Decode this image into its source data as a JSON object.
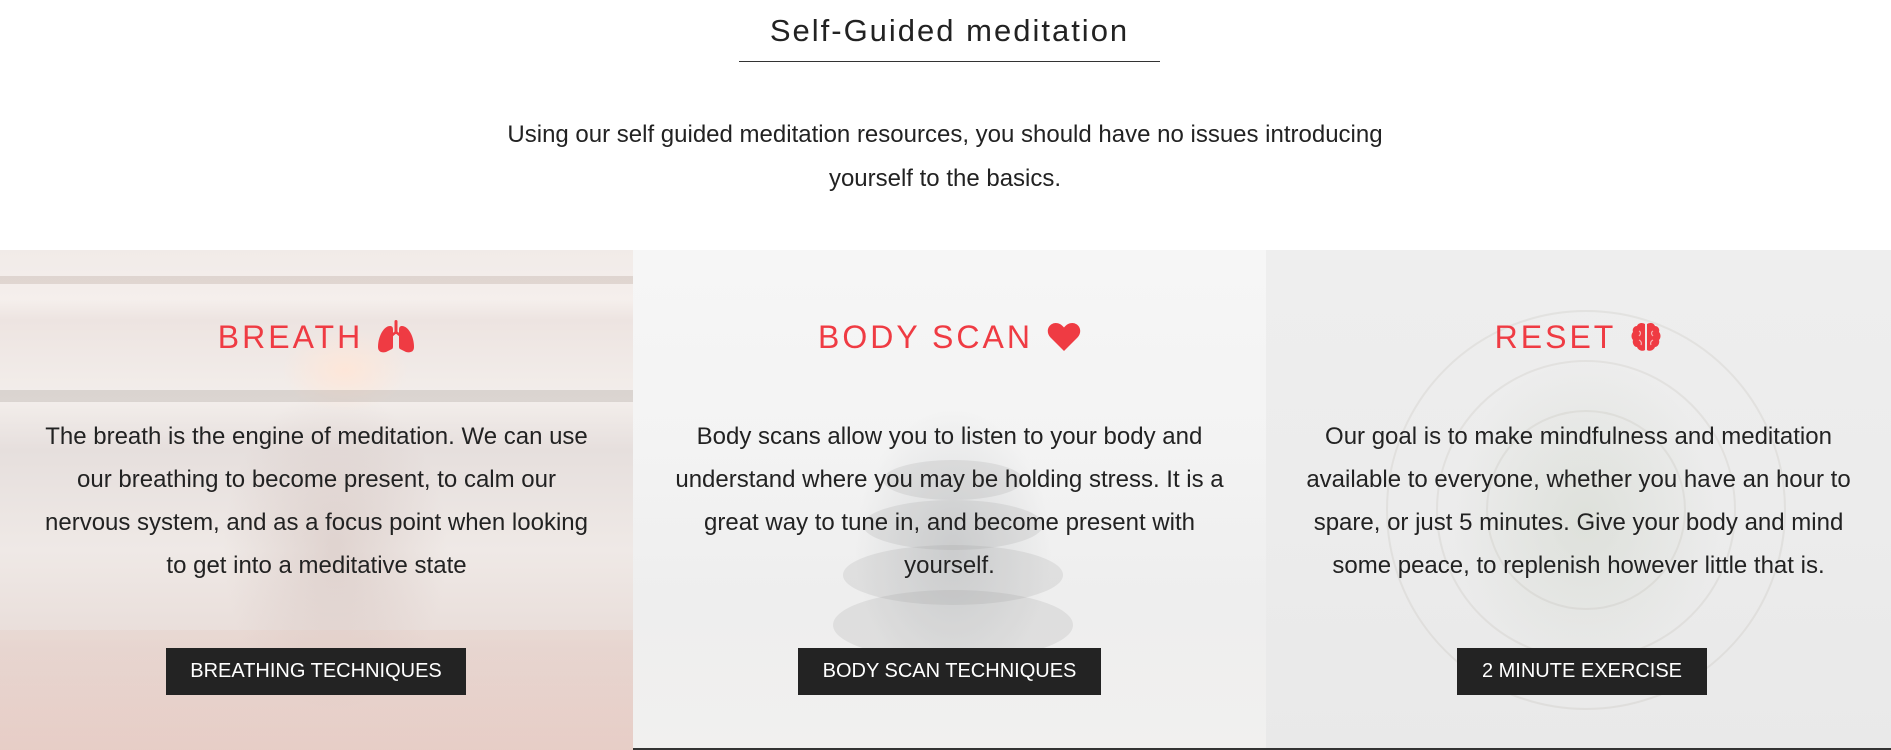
{
  "intro": {
    "title": "Self-Guided meditation",
    "subtitle": "Using our self guided meditation resources, you should have no issues introducing yourself to the basics."
  },
  "panels": [
    {
      "heading": "BREATH",
      "icon": "lungs-icon",
      "text": "The breath is the engine of meditation. We can use our breathing to become present, to calm our nervous system, and as a focus point when looking to get into a meditative state",
      "button_label": "BREATHING TECHNIQUES"
    },
    {
      "heading": "BODY SCAN",
      "icon": "heart-icon",
      "text": "Body scans allow you to listen to your body and understand where you may be holding stress. It is a great way to tune in, and become present with yourself.",
      "button_label": "BODY SCAN TECHNIQUES"
    },
    {
      "heading": "RESET",
      "icon": "brain-icon",
      "text": "Our goal is to make mindfulness and meditation available to everyone, whether you have an hour to spare, or just 5 minutes. Give your body and mind some peace, to replenish however little that is.",
      "button_label": "2 MINUTE EXERCISE"
    }
  ],
  "colors": {
    "accent": "#ef3b43",
    "text": "#222222",
    "button_bg": "#232323",
    "button_text": "#ffffff"
  }
}
